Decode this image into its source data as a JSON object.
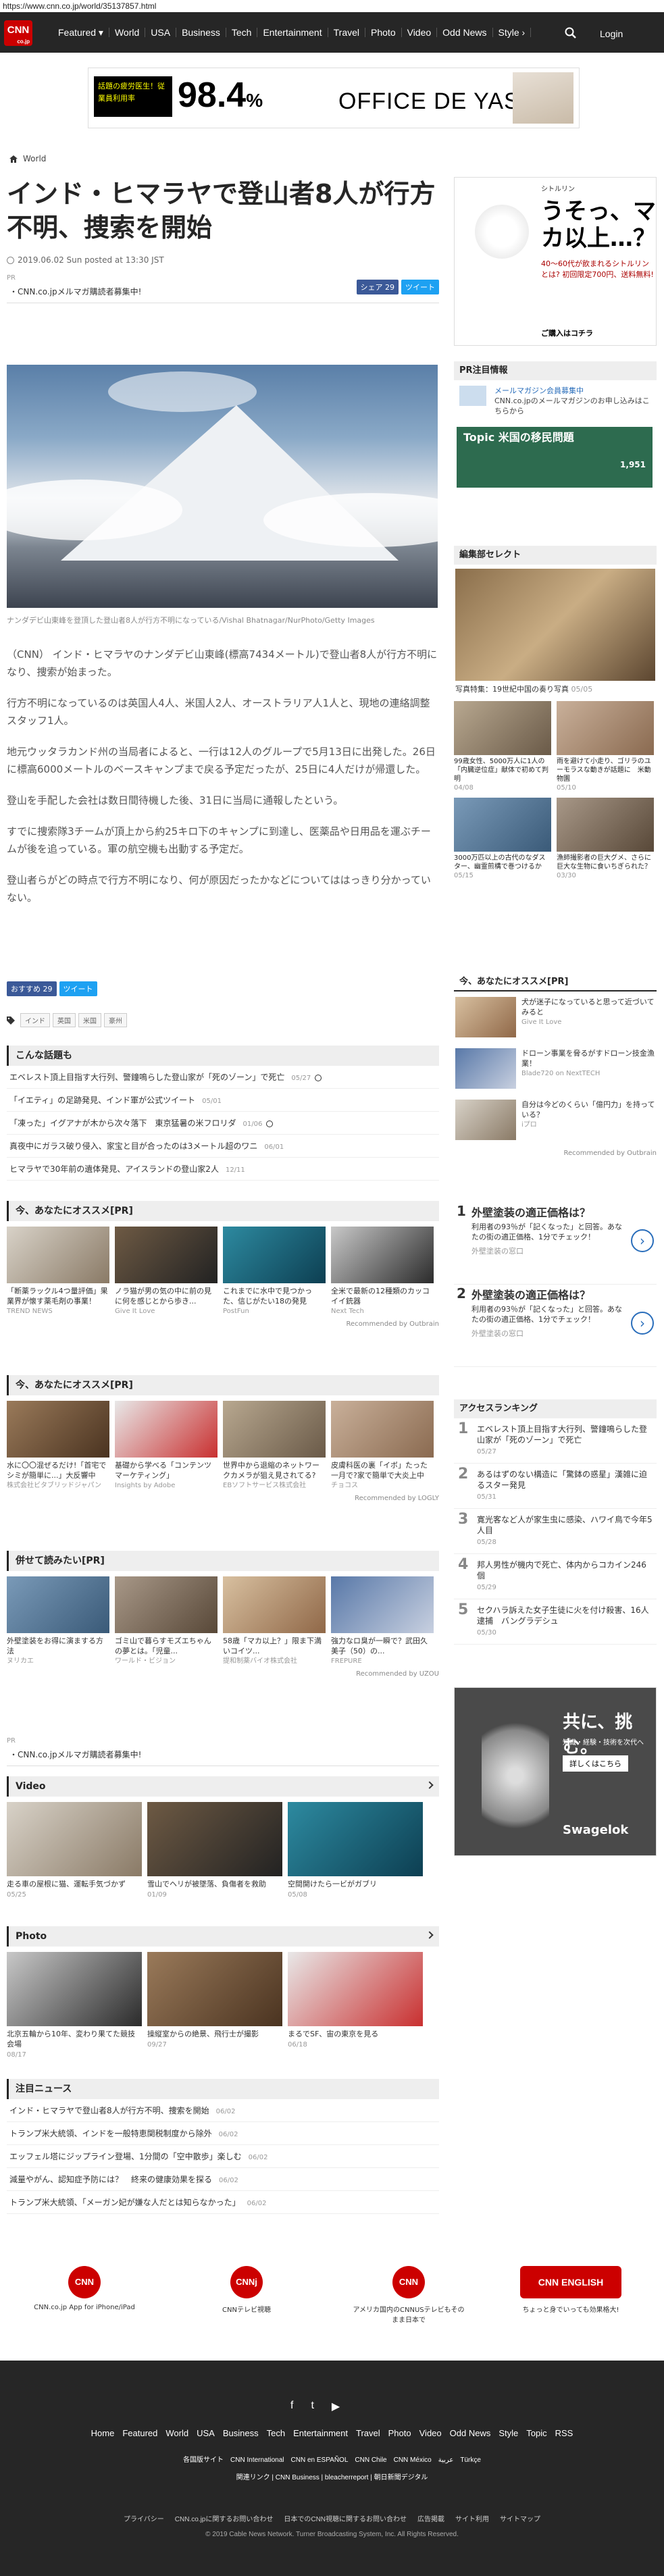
{
  "url": "https://www.cnn.co.jp/world/35137857.html",
  "nav": {
    "logo": "CNN",
    "logo_sub": "co.jp",
    "items": [
      "Featured ▾",
      "World",
      "USA",
      "Business",
      "Tech",
      "Entertainment",
      "Travel",
      "Photo",
      "Video",
      "Odd News",
      "Style ›"
    ],
    "login": "Login"
  },
  "ad_banner": {
    "tag": "話題の疲労医生！従業員利用率",
    "value": "98.4",
    "unit": "%",
    "brand": "OFFICE DE YASAI"
  },
  "breadcrumb": {
    "section": "World"
  },
  "article": {
    "title": "インド・ヒマラヤで登山者8人が行方不明、捜索を開始",
    "date": "2019.06.02 Sun posted at 13:30 JST",
    "share_fb": "シェア 29",
    "share_tw": "ツイート",
    "pr_label": "PR",
    "pr_line": "・CNN.co.jpメルマガ購読者募集中!",
    "caption": "ナンダデビ山東峰を登頂した登山者8人が行方不明になっている/Vishal Bhatnagar/NurPhoto/Getty Images",
    "paragraphs": [
      "（CNN） インド・ヒマラヤのナンダデビ山東峰(標高7434メートル)で登山者8人が行方不明になり、捜索が始まった。",
      "行方不明になっているのは英国人4人、米国人2人、オーストラリア人1人と、現地の連絡調整スタッフ1人。",
      "地元ウッタラカンド州の当局者によると、一行は12人のグループで5月13日に出発した。26日に標高6000メートルのベースキャンプまで戻る予定だったが、25日に4人だけが帰還した。",
      "登山を手配した会社は数日間待機した後、31日に当局に通報したという。",
      "すでに捜索隊3チームが頂上から約25キロ下のキャンプに到達し、医薬品や日用品を運ぶチームが後を追っている。軍の航空機も出動する予定だ。",
      "登山者らがどの時点で行方不明になり、何が原因だったかなどについてははっきり分かっていない。"
    ],
    "share2_fb": "おすすめ 29",
    "share2_tw": "ツイート",
    "tags": [
      "インド",
      "英国",
      "米国",
      "豪州"
    ]
  },
  "related": {
    "title": "こんな話題も",
    "items": [
      {
        "text": "エベレスト頂上目指す大行列、警鐘鳴らした登山家が「死のゾーン」で死亡",
        "date": "05/27"
      },
      {
        "text": "「イエティ」の足跡発見、インド軍が公式ツイート",
        "date": "05/01"
      },
      {
        "text": "「凍った」イグアナが木から次々落下　東京猛暑の米フロリダ",
        "date": "01/06"
      },
      {
        "text": "真夜中にガラス破り侵入、家宝と目が合ったのは3メートル超のワニ",
        "date": "06/01"
      },
      {
        "text": "ヒマラヤで30年前の遺体発見、アイスランドの登山家2人",
        "date": "12/11"
      }
    ]
  },
  "reco1": {
    "title": "今、あなたにオススメ[PR]",
    "cards": [
      {
        "text": "「断薬ラックル4つ量評価」果業界が懐す薬毛剤の事業！",
        "src": "TREND NEWS"
      },
      {
        "text": "ノラ猫が男の気の中に前の見に何を感じとから歩き...",
        "src": "Give It Love"
      },
      {
        "text": "これまでに水中で見つかった、信じがたい18の発見",
        "src": "PostFun"
      },
      {
        "text": "全米で最新の12種類のカッコイイ銃器",
        "src": "Next Tech"
      }
    ],
    "recommended": "Recommended by Outbrain"
  },
  "reco2": {
    "title": "今、あなたにオススメ[PR]",
    "cards": [
      {
        "text": "水に〇〇混ぜるだけ!「首宅でシミが簡単に...」大反響中",
        "src": "株式会社ビタブリッドジャパン"
      },
      {
        "text": "基礎から学べる「コンテンツマーケティング」",
        "src": "Insights by Adobe"
      },
      {
        "text": "世界中から退縮のネットワークカメラが狙え見されてる?",
        "src": "EBソフトサービス株式会社"
      },
      {
        "text": "皮膚科医の裏「イボ」たった一月で?家で簡単で大炎上中",
        "src": "チョコス"
      }
    ],
    "recommended": "Recommended by LOGLY"
  },
  "reco3": {
    "title": "併せて読みたい[PR]",
    "cards": [
      {
        "text": "外壁塗装をお得に演まする方法",
        "src": "ヌリカエ"
      },
      {
        "text": "ゴミ山で暮らすモズエちゃんの夢とは。「児童...",
        "src": "ワールド・ビジョン"
      },
      {
        "text": "58歳「マカ以上？」限ま下満いコイツ...",
        "src": "提和制薬バイオ株式会社"
      },
      {
        "text": "強力なロ臭が一瞬で？武田久美子（50）の...",
        "src": "FREPURE"
      }
    ],
    "recommended": "Recommended by UZOU"
  },
  "pr2": {
    "label": "PR",
    "line": "・CNN.co.jpメルマガ購読者募集中!"
  },
  "video": {
    "title": "Video",
    "cards": [
      {
        "text": "走る車の屋根に猫、運転手気づかず",
        "date": "05/25"
      },
      {
        "text": "雪山でヘリが被墜落、負傷者を救助",
        "date": "01/09"
      },
      {
        "text": "空間開けたら一ビがガブリ",
        "date": "05/08"
      }
    ]
  },
  "photo": {
    "title": "Photo",
    "cards": [
      {
        "text": "北京五輪から10年、変わり果てた競技会場",
        "date": "08/17"
      },
      {
        "text": "操縦室からの絶景、飛行士が撮影",
        "date": "09/27"
      },
      {
        "text": "まるでSF、宙の東京を見る",
        "date": "06/18"
      }
    ]
  },
  "notice": {
    "title": "注目ニュース",
    "items": [
      {
        "text": "インド・ヒマラヤで登山者8人が行方不明、捜索を開始",
        "date": "06/02"
      },
      {
        "text": "トランプ米大統領、インドを一般特恵関税制度から除外",
        "date": "06/02"
      },
      {
        "text": "エッフェル塔にジップライン登場、1分間の「空中散歩」楽しむ",
        "date": "06/02"
      },
      {
        "text": "減量やがん、認知症予防には？　終来の健康効果を探る",
        "date": "06/02"
      },
      {
        "text": "トランプ米大統領、「メーガン妃が嫌な人だとは知らなかった」",
        "date": "06/02"
      }
    ]
  },
  "side_ad": {
    "brand": "シトルリン",
    "headline": "うそっ、マカ以上…？",
    "sub": "40〜60代が飲まれるシトルリンとは? 初回限定700円、送料無料!",
    "cta": "ご購入はコチラ"
  },
  "side_pr": {
    "title": "PR注目情報",
    "line1": "メールマガジン会員募集中",
    "line2": "CNN.co.jpのメールマガジンのお申し込みはこちらから",
    "topic": "Topic 米国の移民問題",
    "topic_num": "1,951"
  },
  "editor": {
    "title": "編集部セレクト",
    "main_caption": "写真特集：19世紀中国の奏り写真",
    "main_date": "05/05",
    "items": [
      {
        "text": "99歳女性、5000万人に1人の「内臓逆位症」献体で初めて判明",
        "date": "04/08"
      },
      {
        "text": "雨を避けて小走り、ゴリラのユーモラスな動きが話題に　米動物園",
        "date": "05/10"
      },
      {
        "text": "3000万匹以上の古代のなダスター、幽霊煎構で巻つけるか",
        "date": "05/15"
      },
      {
        "text": "漁師撮影者の巨大グメ、さらに巨大な生物に食いちぎられた？",
        "date": "03/30"
      }
    ]
  },
  "side_reco": {
    "title": "今、あなたにオススメ[PR]",
    "items": [
      {
        "text": "犬が迷子になっていると思って近づいてみると",
        "src": "Give It Love"
      },
      {
        "text": "ドローン事業を脅るがすドローン技金漁業！",
        "src": "Blade720 on NextTECH"
      },
      {
        "text": "自分は今どのくらい「億円力」を持っている？",
        "src": "iプロ"
      }
    ],
    "recommended": "Recommended by Outbrain"
  },
  "side_ads": [
    {
      "title": "外壁塗装の適正価格は？",
      "sub": "利用者の93％が「記くなった」と回答。あなたの街の適正価格、1分でチェック！",
      "src": "外壁塗装の窓口"
    },
    {
      "title": "外壁塗装の適正価格は？",
      "sub": "利用者の93％が「記くなった」と回答。あなたの街の適正価格、1分でチェック！",
      "src": "外壁塗装の窓口"
    }
  ],
  "ranking": {
    "title": "アクセスランキング",
    "items": [
      {
        "n": "1",
        "text": "エベレスト頂上目指す大行列、警鐘鳴らした登山家が「死のゾーン」で死亡",
        "date": "05/27"
      },
      {
        "n": "2",
        "text": "あるはずのない構造に「驚鉢の惑星」漢雑に迫るスター発見",
        "date": "05/31"
      },
      {
        "n": "3",
        "text": "寛光客など人が家生虫に感染、ハワイ鳥で今年5人目",
        "date": "05/28"
      },
      {
        "n": "4",
        "text": "邦人男性が機内で死亡、体内からコカイン246個",
        "date": "05/29"
      },
      {
        "n": "5",
        "text": "セクハラ訴えた女子生徒に火を付け殺害、16人逮捕　バングラデシュ",
        "date": "05/30"
      }
    ]
  },
  "side_ad2": {
    "headline": "共に、挑む。",
    "sub": "知識・経験・技術を次代へ",
    "cta": "詳しくはこちら",
    "brand": "Swagelok"
  },
  "apps": [
    {
      "logo": "CNN",
      "text": "CNN.co.jp App for iPhone/iPad"
    },
    {
      "logo": "CNNj",
      "text": "CNNテレビ視聴"
    },
    {
      "logo": "CNN US",
      "text": "アメリカ国内のCNNUSテレビもそのまま日本で"
    },
    {
      "logo": "CNN ENGLISH",
      "text": "ちょっと身でいっても効果格大!"
    }
  ],
  "footer": {
    "social": [
      "f",
      "t",
      "▶"
    ],
    "links": [
      "Home",
      "Featured",
      "World",
      "USA",
      "Business",
      "Tech",
      "Entertainment",
      "Travel",
      "Photo",
      "Video",
      "Odd News",
      "Style",
      "Topic",
      "RSS"
    ],
    "links2": [
      "各国版サイト",
      "CNN International",
      "CNN en ESPAÑOL",
      "CNN Chile",
      "CNN México",
      "عربية",
      "Türkçe"
    ],
    "links3": "関連リンク | CNN Business | bleacherreport | 朝日新聞デジタル",
    "links4": [
      "プライバシー",
      "CNN.co.jpに関するお問い合わせ",
      "日本でのCNN視聴に関するお問い合わせ",
      "広告掲載",
      "サイト利用",
      "サイトマップ"
    ],
    "copy": "© 2019 Cable News Network.  Turner Broadcasting System, Inc.  All Rights Reserved."
  }
}
